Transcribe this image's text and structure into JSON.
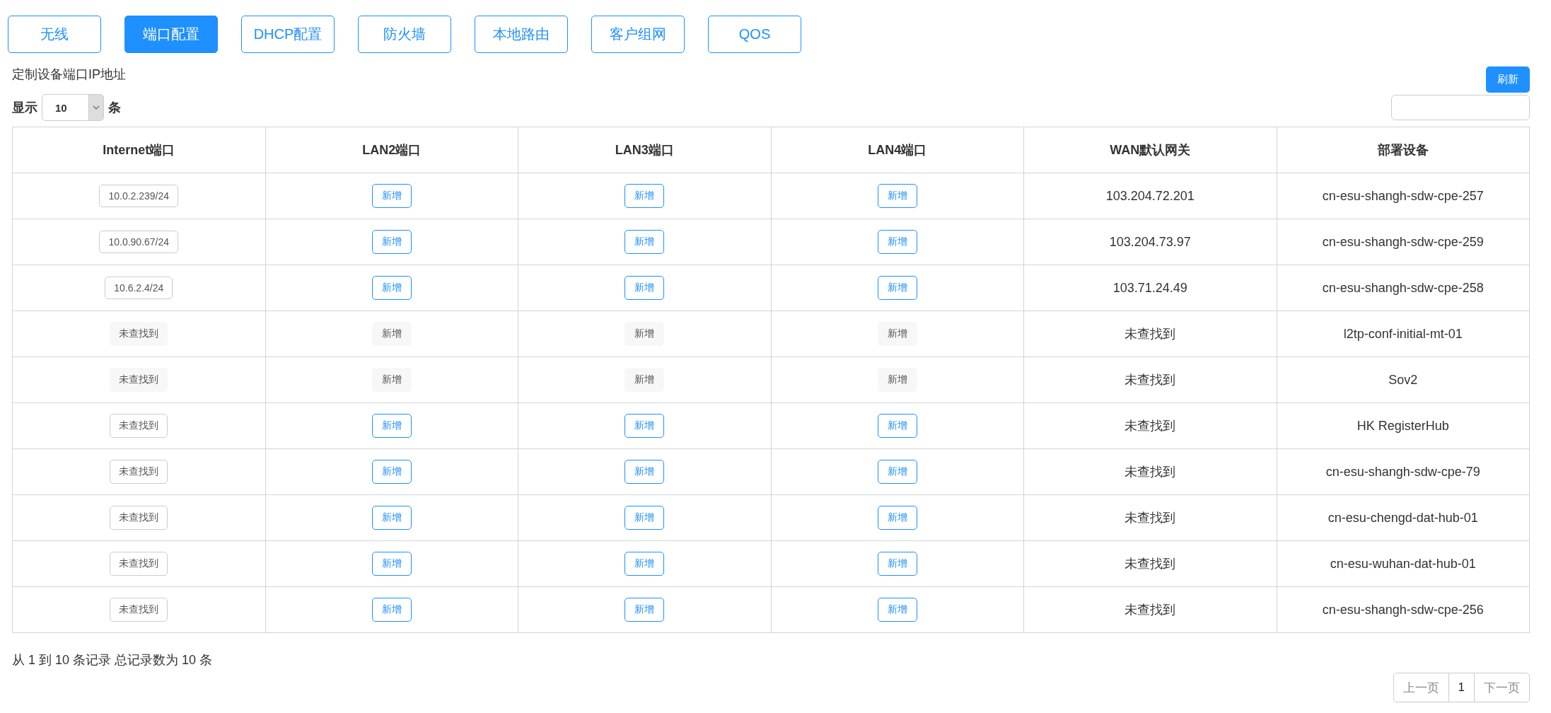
{
  "tabs": [
    {
      "label": "无线",
      "selected": false
    },
    {
      "label": "端口配置",
      "selected": true
    },
    {
      "label": "DHCP配置",
      "selected": false
    },
    {
      "label": "防火墙",
      "selected": false
    },
    {
      "label": "本地路由",
      "selected": false
    },
    {
      "label": "客户组网",
      "selected": false
    },
    {
      "label": "QOS",
      "selected": false
    }
  ],
  "heading": "定制设备端口IP地址",
  "refresh_button": "刷新",
  "page_size": {
    "prefix": "显示",
    "value": "10",
    "suffix": "条"
  },
  "table": {
    "columns": [
      "Internet端口",
      "LAN2端口",
      "LAN3端口",
      "LAN4端口",
      "WAN默认网关",
      "部署设备"
    ],
    "rows": [
      {
        "internet": {
          "text": "10.0.2.239/24",
          "disabled": false
        },
        "lan2": {
          "label": "新增",
          "disabled": false
        },
        "lan3": {
          "label": "新增",
          "disabled": false
        },
        "lan4": {
          "label": "新增",
          "disabled": false
        },
        "wan": "103.204.72.201",
        "device": "cn-esu-shangh-sdw-cpe-257"
      },
      {
        "internet": {
          "text": "10.0.90.67/24",
          "disabled": false
        },
        "lan2": {
          "label": "新增",
          "disabled": false
        },
        "lan3": {
          "label": "新增",
          "disabled": false
        },
        "lan4": {
          "label": "新增",
          "disabled": false
        },
        "wan": "103.204.73.97",
        "device": "cn-esu-shangh-sdw-cpe-259"
      },
      {
        "internet": {
          "text": "10.6.2.4/24",
          "disabled": false
        },
        "lan2": {
          "label": "新增",
          "disabled": false
        },
        "lan3": {
          "label": "新增",
          "disabled": false
        },
        "lan4": {
          "label": "新增",
          "disabled": false
        },
        "wan": "103.71.24.49",
        "device": "cn-esu-shangh-sdw-cpe-258"
      },
      {
        "internet": {
          "text": "未查找到",
          "disabled": true
        },
        "lan2": {
          "label": "新增",
          "disabled": true
        },
        "lan3": {
          "label": "新增",
          "disabled": true
        },
        "lan4": {
          "label": "新增",
          "disabled": true
        },
        "wan": "未查找到",
        "device": "l2tp-conf-initial-mt-01"
      },
      {
        "internet": {
          "text": "未查找到",
          "disabled": true
        },
        "lan2": {
          "label": "新增",
          "disabled": true
        },
        "lan3": {
          "label": "新增",
          "disabled": true
        },
        "lan4": {
          "label": "新增",
          "disabled": true
        },
        "wan": "未查找到",
        "device": "Sov2"
      },
      {
        "internet": {
          "text": "未查找到",
          "disabled": false
        },
        "lan2": {
          "label": "新增",
          "disabled": false
        },
        "lan3": {
          "label": "新增",
          "disabled": false
        },
        "lan4": {
          "label": "新增",
          "disabled": false
        },
        "wan": "未查找到",
        "device": "HK RegisterHub"
      },
      {
        "internet": {
          "text": "未查找到",
          "disabled": false
        },
        "lan2": {
          "label": "新增",
          "disabled": false
        },
        "lan3": {
          "label": "新增",
          "disabled": false
        },
        "lan4": {
          "label": "新增",
          "disabled": false
        },
        "wan": "未查找到",
        "device": "cn-esu-shangh-sdw-cpe-79"
      },
      {
        "internet": {
          "text": "未查找到",
          "disabled": false
        },
        "lan2": {
          "label": "新增",
          "disabled": false
        },
        "lan3": {
          "label": "新增",
          "disabled": false
        },
        "lan4": {
          "label": "新增",
          "disabled": false
        },
        "wan": "未查找到",
        "device": "cn-esu-chengd-dat-hub-01"
      },
      {
        "internet": {
          "text": "未查找到",
          "disabled": false
        },
        "lan2": {
          "label": "新增",
          "disabled": false
        },
        "lan3": {
          "label": "新增",
          "disabled": false
        },
        "lan4": {
          "label": "新增",
          "disabled": false
        },
        "wan": "未查找到",
        "device": "cn-esu-wuhan-dat-hub-01"
      },
      {
        "internet": {
          "text": "未查找到",
          "disabled": false
        },
        "lan2": {
          "label": "新增",
          "disabled": false
        },
        "lan3": {
          "label": "新增",
          "disabled": false
        },
        "lan4": {
          "label": "新增",
          "disabled": false
        },
        "wan": "未查找到",
        "device": "cn-esu-shangh-sdw-cpe-256"
      }
    ]
  },
  "summary": "从 1 到 10 条记录 总记录数为 10 条",
  "pagination": [
    {
      "label": "上一页",
      "disabled": true,
      "selected": false
    },
    {
      "label": "1",
      "disabled": false,
      "selected": true
    },
    {
      "label": "下一页",
      "disabled": true,
      "selected": false
    }
  ]
}
